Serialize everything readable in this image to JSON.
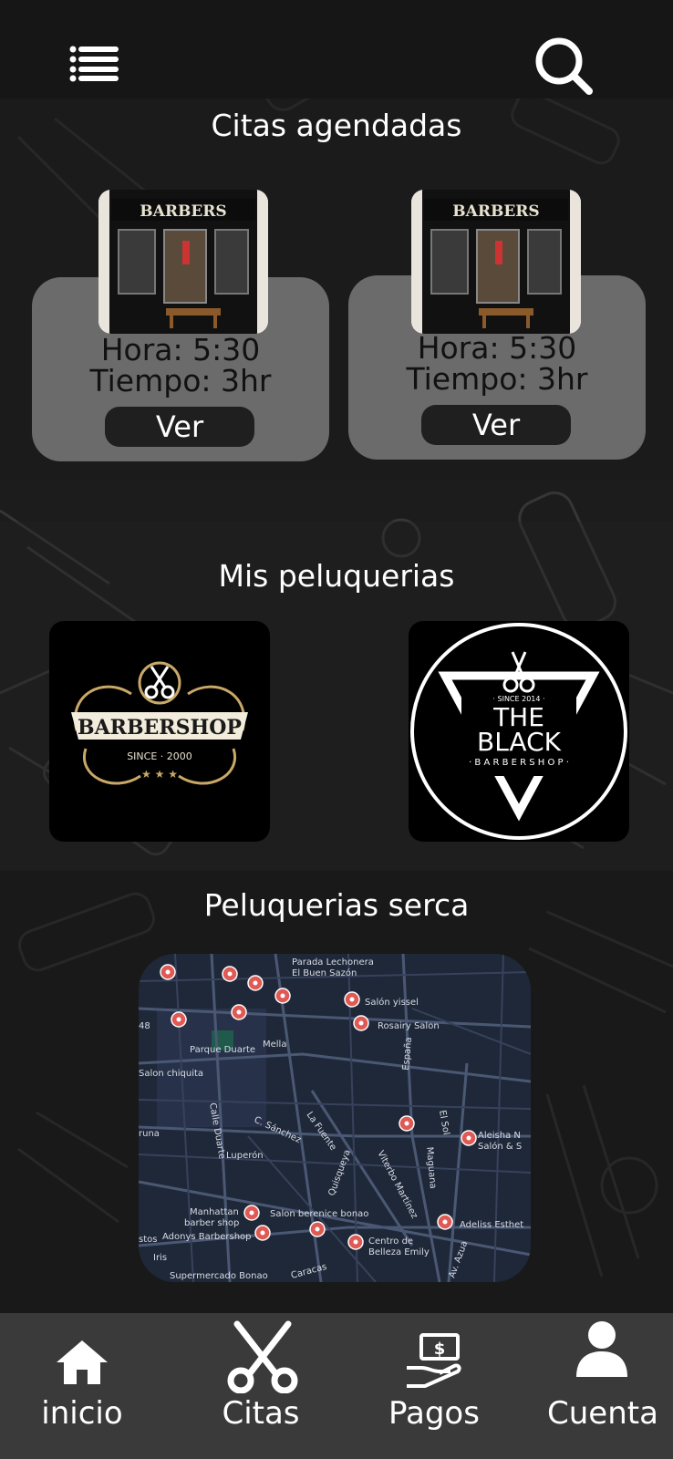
{
  "header": {
    "menu_icon": "menu-icon",
    "search_icon": "search-icon"
  },
  "appointments": {
    "title": "Citas agendadas",
    "cards": [
      {
        "shop_sign": "BARBERS",
        "time": "Hora: 5:30",
        "duration": "Tiempo: 3hr",
        "button": "Ver"
      },
      {
        "shop_sign": "BARBERS",
        "time": "Hora: 5:30",
        "duration": "Tiempo: 3hr",
        "button": "Ver"
      }
    ]
  },
  "my_shops": {
    "title": "Mis peluquerias",
    "shops": [
      {
        "logo_text": "BARBERSHOP",
        "logo_sub": "SINCE · 2000"
      },
      {
        "logo_since": "· SINCE 2014 ·",
        "logo_line1": "THE",
        "logo_line2": "BLACK",
        "logo_sub": "· B A R B E R S H O P ·"
      }
    ]
  },
  "nearby": {
    "title": "Peluquerias serca",
    "map_labels": {
      "l1": "Parada Lechonera",
      "l2": "El Buen Sazón",
      "l3": "Salón yissel",
      "l4": "Rosairy Salon",
      "l5": "48",
      "l6": "Parque Duarte",
      "l7": "Mella",
      "l8": "Salon chiquita",
      "l9": "España",
      "l10": "C. Sánchez",
      "l11": "La Fuente",
      "l12": "El Sol",
      "l13": "Aleisha N",
      "l14": "Salón & S",
      "l15": "Calle Duarte",
      "l16": "Luperón",
      "l17": "Quisqueya",
      "l18": "Viterbo Martínez",
      "l19": "Maguana",
      "l20": "Manhattan",
      "l21": "barber shop",
      "l22": "Salon berenice bonao",
      "l23": "Adonys Barbershop",
      "l24": "Adeliss Esthet",
      "l25": "Centro de",
      "l26": "Belleza Emily",
      "l27": "Iris",
      "l28": "Supermercado Bonao",
      "l29": "Caracas",
      "l30": "Av. Azua",
      "l31": "runa",
      "l32": "stos"
    }
  },
  "bottom_nav": {
    "items": [
      {
        "label": "inicio",
        "icon": "home-icon"
      },
      {
        "label": "Citas",
        "icon": "scissors-icon"
      },
      {
        "label": "Pagos",
        "icon": "payment-icon"
      },
      {
        "label": "Cuenta",
        "icon": "user-icon"
      }
    ]
  },
  "colors": {
    "background": "#1c1c1c",
    "card": "#6b6b6b",
    "button": "#1f1f1f",
    "nav": "#3a3a3a",
    "map": "#1e2637",
    "pin": "#e05a55"
  }
}
